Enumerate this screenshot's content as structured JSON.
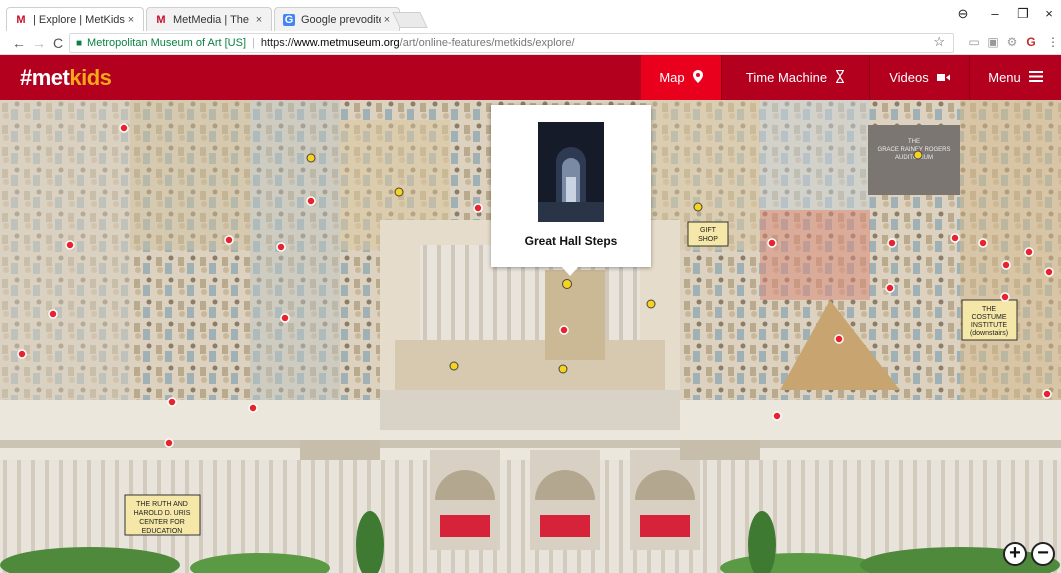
{
  "browser": {
    "tabs": [
      {
        "title": "| Explore | MetKids | The",
        "favicon": "met-favicon",
        "active": true
      },
      {
        "title": "MetMedia | The Metropo",
        "favicon": "met-favicon",
        "active": false
      },
      {
        "title": "Google prevoditelj",
        "favicon": "translate-favicon",
        "active": false
      }
    ],
    "close_glyph": "×",
    "window_controls": {
      "account": "⊖",
      "minimize": "–",
      "maximize": "❐",
      "close": "×"
    },
    "nav": {
      "back": "←",
      "forward": "→",
      "reload": "C"
    },
    "address": {
      "site_name": "Metropolitan Museum of Art [US]",
      "separator": "|",
      "scheme": "https://",
      "host": "www.metmuseum.org",
      "path": "/art/online-features/metkids/explore/"
    },
    "star": "☆"
  },
  "site": {
    "logo_hash": "#met",
    "logo_kids": "kids",
    "brand_color": "#b2001e",
    "nav": [
      {
        "label": "Map",
        "icon": "map-pin-icon",
        "glyph": "⬤",
        "active": true
      },
      {
        "label": "Time Machine",
        "icon": "hourglass-icon",
        "glyph": "⌛",
        "active": false
      },
      {
        "label": "Videos",
        "icon": "video-camera-icon",
        "glyph": "■",
        "active": false
      },
      {
        "label": "Menu",
        "icon": "hamburger-menu-icon",
        "glyph": "≡",
        "active": false
      }
    ]
  },
  "map": {
    "popup_title": "Great Hall Steps",
    "signs": {
      "gift_shop": "GIFT SHOP",
      "auditorium": "THE GRACE RAINEY ROGERS AUDITORIUM",
      "costume": "THE COSTUME INSTITUTE (downstairs)",
      "education": "THE RUTH AND HAROLD D. URIS CENTER FOR EDUCATION"
    },
    "zoom_in": "+",
    "zoom_out": "−"
  }
}
